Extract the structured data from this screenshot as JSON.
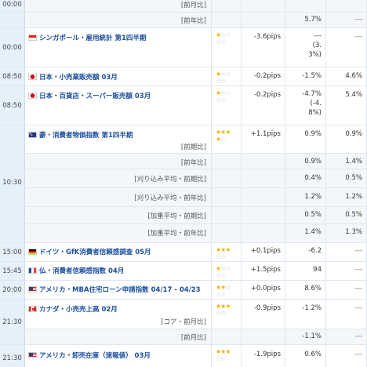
{
  "rows": [
    {
      "kind": "sub",
      "time": "00:00",
      "label": "[前月比]",
      "prev": "",
      "forecast": "",
      "actual": "",
      "stars": "off3"
    },
    {
      "kind": "sub",
      "time": "",
      "label": "[前年比]",
      "prev": "5.7%",
      "forecast": "---",
      "actual": ""
    },
    {
      "kind": "event",
      "time": "00:00",
      "flag": "singapore",
      "name": "シンガポール・雇用統計 第1四半期",
      "stars_on": 1,
      "pips": "-3.6pips",
      "prev": "---\n(3.\n3%)",
      "forecast": "---",
      "actual": ""
    },
    {
      "kind": "event",
      "time": "08:50",
      "flag": "japan",
      "name": "日本・小売業販売額 03月",
      "stars_on": 1,
      "pips": "-0.2pips",
      "prev": "-1.5%",
      "forecast": "4.6%",
      "actual": ""
    },
    {
      "kind": "event",
      "time": "08:50",
      "flag": "japan",
      "name": "日本・百貨店・スーパー販売額 03月",
      "stars_on": 1,
      "pips": "-0.2pips",
      "prev": "-4.7%\n(-4.\n8%)",
      "forecast": "5.4%",
      "actual": ""
    },
    {
      "kind": "event",
      "time": "",
      "flag": "australia",
      "name": "豪・消費者物価指数 第1四半期",
      "stars_on": 4,
      "pips": "+1.1pips",
      "label": "[前期比]",
      "prev": "0.9%",
      "forecast": "0.9%",
      "actual": ""
    },
    {
      "kind": "sub",
      "label": "[前年比]",
      "prev": "0.9%",
      "forecast": "1.4%",
      "actual": ""
    },
    {
      "kind": "sub",
      "time": "10:30",
      "label": "[刈り込み平均・前期比]",
      "prev": "0.4%",
      "forecast": "0.5%",
      "actual": ""
    },
    {
      "kind": "sub",
      "label": "[刈り込み平均・前年比]",
      "prev": "1.2%",
      "forecast": "1.2%",
      "actual": ""
    },
    {
      "kind": "sub",
      "label": "[加重平均・前期比]",
      "prev": "0.5%",
      "forecast": "0.5%",
      "actual": ""
    },
    {
      "kind": "sub",
      "label": "[加重平均・前年比]",
      "prev": "1.4%",
      "forecast": "1.3%",
      "actual": ""
    },
    {
      "kind": "event",
      "time": "15:00",
      "flag": "germany",
      "name": "ドイツ・GfK消費者信頼感調査 05月",
      "stars_on": 3,
      "pips": "+0.1pips",
      "prev": "-6.2",
      "forecast": "---",
      "actual": ""
    },
    {
      "kind": "event",
      "time": "15:45",
      "flag": "france",
      "name": "仏・消費者信頼感指数 04月",
      "stars_on": 1,
      "pips": "+1.5pips",
      "prev": "94",
      "forecast": "---",
      "actual": ""
    },
    {
      "kind": "event",
      "time": "20:00",
      "flag": "usa",
      "name": "アメリカ・MBA住宅ローン申請指数 04/17 - 04/23",
      "stars_on": 2,
      "pips": "+0.0pips",
      "prev": "8.6%",
      "forecast": "---",
      "actual": ""
    },
    {
      "kind": "event",
      "time": "21:30",
      "flag": "canada",
      "name": "カナダ・小売売上高 02月",
      "stars_on": 3,
      "pips": "-0.9pips",
      "label": "[コア・前月比]",
      "prev": "-1.2%",
      "forecast": "---",
      "actual": ""
    },
    {
      "kind": "sub",
      "label": "[前月比]",
      "prev": "-1.1%",
      "forecast": "---",
      "actual": ""
    },
    {
      "kind": "event",
      "time": "21:30",
      "flag": "usa",
      "name": "アメリカ・卸売在庫（速報値） 03月",
      "stars_on": 3,
      "pips": "-1.9pips",
      "prev": "0.6%",
      "forecast": "---",
      "actual": ""
    }
  ],
  "display": {
    "r0_time": "00:00",
    "r0_label": "[前月比]",
    "r1_label": "[前年比]",
    "r1_prev": "5.7%",
    "r1_fc": "---",
    "r2_time": "00:00",
    "r2_name": "シンガポール・雇用統計 第1四半期",
    "r2_pips": "-3.6pips",
    "r2_prev1": "---",
    "r2_prev2": "(3.",
    "r2_prev3": "3%)",
    "r2_fc": "---",
    "r3_time": "08:50",
    "r3_name": "日本・小売業販売額 03月",
    "r3_pips": "-0.2pips",
    "r3_prev": "-1.5%",
    "r3_fc": "4.6%",
    "r4_time": "08:50",
    "r4_name": "日本・百貨店・スーパー販売額 03月",
    "r4_pips": "-0.2pips",
    "r4_prev1": "-4.7%",
    "r4_prev2": "(-4.",
    "r4_prev3": "8%)",
    "r4_fc": "5.4%",
    "r5_name": "豪・消費者物価指数 第1四半期",
    "r5_label": "[前期比]",
    "r5_pips": "+1.1pips",
    "r5_prev": "0.9%",
    "r5_fc": "0.9%",
    "r6_label": "[前年比]",
    "r6_prev": "0.9%",
    "r6_fc": "1.4%",
    "r7_time": "10:30",
    "r7_label": "[刈り込み平均・前期比]",
    "r7_prev": "0.4%",
    "r7_fc": "0.5%",
    "r8_label": "[刈り込み平均・前年比]",
    "r8_prev": "1.2%",
    "r8_fc": "1.2%",
    "r9_label": "[加重平均・前期比]",
    "r9_prev": "0.5%",
    "r9_fc": "0.5%",
    "r10_label": "[加重平均・前年比]",
    "r10_prev": "1.4%",
    "r10_fc": "1.3%",
    "r11_time": "15:00",
    "r11_name": "ドイツ・GfK消費者信頼感調査 05月",
    "r11_pips": "+0.1pips",
    "r11_prev": "-6.2",
    "r11_fc": "---",
    "r12_time": "15:45",
    "r12_name": "仏・消費者信頼感指数 04月",
    "r12_pips": "+1.5pips",
    "r12_prev": "94",
    "r12_fc": "---",
    "r13_time": "20:00",
    "r13_name": "アメリカ・MBA住宅ローン申請指数 04/17 - 04/23",
    "r13_pips": "+0.0pips",
    "r13_prev": "8.6%",
    "r13_fc": "---",
    "r14_time": "21:30",
    "r14_name": "カナダ・小売売上高 02月",
    "r14_label": "[コア・前月比]",
    "r14_pips": "-0.9pips",
    "r14_prev": "-1.2%",
    "r14_fc": "---",
    "r15_label": "[前月比]",
    "r15_prev": "-1.1%",
    "r15_fc": "---",
    "r16_time": "21:30",
    "r16_name": "アメリカ・卸売在庫（速報値） 03月",
    "r16_pips": "-1.9pips",
    "r16_prev": "0.6%",
    "r16_fc": "---"
  },
  "importance": {
    "r2": 1,
    "r3": 1,
    "r4": 1,
    "r5": 4,
    "r11": 3,
    "r12": 1,
    "r13": 2,
    "r14": 3,
    "r16": 3
  },
  "colors": {
    "time_bg": "#e6f0fa",
    "name": "#1a4e9c",
    "star_on": "#f0b400",
    "star_off": "#c8ccd2",
    "sub_bg": "#f4f7fa"
  }
}
